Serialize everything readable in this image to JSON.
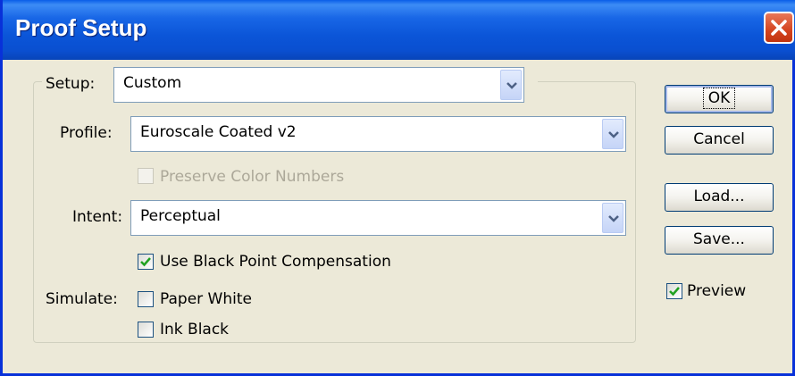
{
  "window": {
    "title": "Proof Setup",
    "close_icon": "close-icon"
  },
  "setup": {
    "label": "Setup:",
    "value": "Custom"
  },
  "profile": {
    "label": "Profile:",
    "value": "Euroscale Coated v2"
  },
  "preserve": {
    "label": "Preserve Color Numbers",
    "checked": false,
    "enabled": false
  },
  "intent": {
    "label": "Intent:",
    "value": "Perceptual"
  },
  "black_point": {
    "label": "Use Black Point Compensation",
    "checked": true
  },
  "simulate": {
    "label": "Simulate:",
    "paper_white": {
      "label": "Paper White",
      "checked": false
    },
    "ink_black": {
      "label": "Ink Black",
      "checked": false
    }
  },
  "buttons": {
    "ok": "OK",
    "cancel": "Cancel",
    "load": "Load...",
    "save": "Save..."
  },
  "preview": {
    "label": "Preview",
    "checked": true
  },
  "colors": {
    "titlebar": "#0b55d8",
    "window_bg": "#ece9d8",
    "close": "#d4441f",
    "check": "#21a121"
  }
}
